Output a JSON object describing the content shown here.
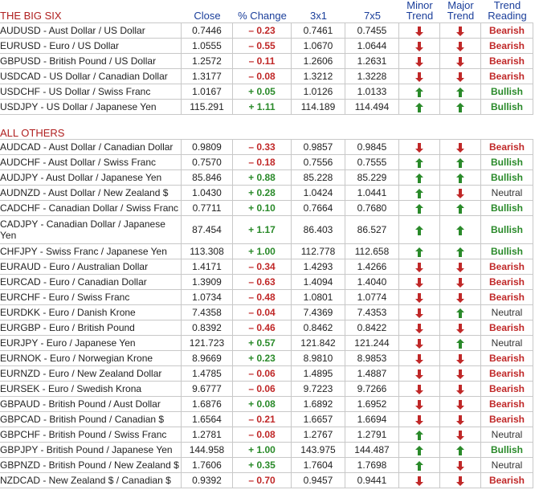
{
  "headers": {
    "section1": "THE BIG SIX",
    "close": "Close",
    "change": "% Change",
    "c3x1": "3x1",
    "c7x5": "7x5",
    "minor_top": "Minor",
    "minor_bottom": "Trend",
    "major_top": "Major",
    "major_bottom": "Trend",
    "reading_top": "Trend",
    "reading_bottom": "Reading"
  },
  "section2": "ALL OTHERS",
  "colors": {
    "up": "#2a8a2a",
    "down": "#c02828",
    "header": "#1a3e9a"
  },
  "big_six": [
    {
      "name": "AUDUSD - Aust Dollar / US Dollar",
      "close": "0.7446",
      "change": "– 0.23",
      "dir": "neg",
      "x31": "0.7461",
      "x75": "0.7455",
      "minor": "down",
      "major": "down",
      "reading": "Bearish"
    },
    {
      "name": "EURUSD - Euro / US Dollar",
      "close": "1.0555",
      "change": "– 0.55",
      "dir": "neg",
      "x31": "1.0670",
      "x75": "1.0644",
      "minor": "down",
      "major": "down",
      "reading": "Bearish"
    },
    {
      "name": "GBPUSD - British Pound / US Dollar",
      "close": "1.2572",
      "change": "– 0.11",
      "dir": "neg",
      "x31": "1.2606",
      "x75": "1.2631",
      "minor": "down",
      "major": "down",
      "reading": "Bearish"
    },
    {
      "name": "USDCAD - US Dollar / Canadian Dollar",
      "close": "1.3177",
      "change": "– 0.08",
      "dir": "neg",
      "x31": "1.3212",
      "x75": "1.3228",
      "minor": "down",
      "major": "down",
      "reading": "Bearish"
    },
    {
      "name": "USDCHF - US Dollar / Swiss Franc",
      "close": "1.0167",
      "change": "+ 0.05",
      "dir": "pos",
      "x31": "1.0126",
      "x75": "1.0133",
      "minor": "up",
      "major": "up",
      "reading": "Bullish"
    },
    {
      "name": "USDJPY - US Dollar / Japanese Yen",
      "close": "115.291",
      "change": "+ 1.11",
      "dir": "pos",
      "x31": "114.189",
      "x75": "114.494",
      "minor": "up",
      "major": "up",
      "reading": "Bullish"
    }
  ],
  "others": [
    {
      "name": "AUDCAD - Aust Dollar / Canadian Dollar",
      "close": "0.9809",
      "change": "– 0.33",
      "dir": "neg",
      "x31": "0.9857",
      "x75": "0.9845",
      "minor": "down",
      "major": "down",
      "reading": "Bearish"
    },
    {
      "name": "AUDCHF - Aust Dollar / Swiss Franc",
      "close": "0.7570",
      "change": "– 0.18",
      "dir": "neg",
      "x31": "0.7556",
      "x75": "0.7555",
      "minor": "up",
      "major": "up",
      "reading": "Bullish"
    },
    {
      "name": "AUDJPY - Aust Dollar / Japanese Yen",
      "close": "85.846",
      "change": "+ 0.88",
      "dir": "pos",
      "x31": "85.228",
      "x75": "85.229",
      "minor": "up",
      "major": "up",
      "reading": "Bullish"
    },
    {
      "name": "AUDNZD - Aust Dollar / New Zealand $",
      "close": "1.0430",
      "change": "+ 0.28",
      "dir": "pos",
      "x31": "1.0424",
      "x75": "1.0441",
      "minor": "up",
      "major": "down",
      "reading": "Neutral"
    },
    {
      "name": "CADCHF - Canadian Dollar / Swiss Franc",
      "close": "0.7711",
      "change": "+ 0.10",
      "dir": "pos",
      "x31": "0.7664",
      "x75": "0.7680",
      "minor": "up",
      "major": "up",
      "reading": "Bullish"
    },
    {
      "name": "CADJPY - Canadian Dollar / Japanese Yen",
      "close": "87.454",
      "change": "+ 1.17",
      "dir": "pos",
      "x31": "86.403",
      "x75": "86.527",
      "minor": "up",
      "major": "up",
      "reading": "Bullish",
      "tall": true
    },
    {
      "name": "CHFJPY - Swiss Franc / Japanese Yen",
      "close": "113.308",
      "change": "+ 1.00",
      "dir": "pos",
      "x31": "112.778",
      "x75": "112.658",
      "minor": "up",
      "major": "up",
      "reading": "Bullish"
    },
    {
      "name": "EURAUD - Euro / Australian Dollar",
      "close": "1.4171",
      "change": "– 0.34",
      "dir": "neg",
      "x31": "1.4293",
      "x75": "1.4266",
      "minor": "down",
      "major": "down",
      "reading": "Bearish"
    },
    {
      "name": "EURCAD - Euro / Canadian Dollar",
      "close": "1.3909",
      "change": "– 0.63",
      "dir": "neg",
      "x31": "1.4094",
      "x75": "1.4040",
      "minor": "down",
      "major": "down",
      "reading": "Bearish"
    },
    {
      "name": "EURCHF - Euro / Swiss Franc",
      "close": "1.0734",
      "change": "– 0.48",
      "dir": "neg",
      "x31": "1.0801",
      "x75": "1.0774",
      "minor": "down",
      "major": "down",
      "reading": "Bearish"
    },
    {
      "name": "EURDKK - Euro / Danish Krone",
      "close": "7.4358",
      "change": "– 0.04",
      "dir": "neg",
      "x31": "7.4369",
      "x75": "7.4353",
      "minor": "down",
      "major": "up",
      "reading": "Neutral"
    },
    {
      "name": "EURGBP - Euro / British Pound",
      "close": "0.8392",
      "change": "– 0.46",
      "dir": "neg",
      "x31": "0.8462",
      "x75": "0.8422",
      "minor": "down",
      "major": "down",
      "reading": "Bearish"
    },
    {
      "name": "EURJPY - Euro / Japanese Yen",
      "close": "121.723",
      "change": "+ 0.57",
      "dir": "pos",
      "x31": "121.842",
      "x75": "121.244",
      "minor": "down",
      "major": "up",
      "reading": "Neutral"
    },
    {
      "name": "EURNOK - Euro / Norwegian Krone",
      "close": "8.9669",
      "change": "+ 0.23",
      "dir": "pos",
      "x31": "8.9810",
      "x75": "8.9853",
      "minor": "down",
      "major": "down",
      "reading": "Bearish"
    },
    {
      "name": "EURNZD - Euro / New Zealand Dollar",
      "close": "1.4785",
      "change": "– 0.06",
      "dir": "neg",
      "x31": "1.4895",
      "x75": "1.4887",
      "minor": "down",
      "major": "down",
      "reading": "Bearish"
    },
    {
      "name": "EURSEK - Euro / Swedish Krona",
      "close": "9.6777",
      "change": "– 0.06",
      "dir": "neg",
      "x31": "9.7223",
      "x75": "9.7266",
      "minor": "down",
      "major": "down",
      "reading": "Bearish"
    },
    {
      "name": "GBPAUD - British Pound / Aust Dollar",
      "close": "1.6876",
      "change": "+ 0.08",
      "dir": "pos",
      "x31": "1.6892",
      "x75": "1.6952",
      "minor": "down",
      "major": "down",
      "reading": "Bearish"
    },
    {
      "name": "GBPCAD - British Pound / Canadian $",
      "close": "1.6564",
      "change": "– 0.21",
      "dir": "neg",
      "x31": "1.6657",
      "x75": "1.6694",
      "minor": "down",
      "major": "down",
      "reading": "Bearish"
    },
    {
      "name": "GBPCHF - British Pound / Swiss Franc",
      "close": "1.2781",
      "change": "– 0.08",
      "dir": "neg",
      "x31": "1.2767",
      "x75": "1.2791",
      "minor": "up",
      "major": "down",
      "reading": "Neutral"
    },
    {
      "name": "GBPJPY - British Pound / Japanese Yen",
      "close": "144.958",
      "change": "+ 1.00",
      "dir": "pos",
      "x31": "143.975",
      "x75": "144.487",
      "minor": "up",
      "major": "up",
      "reading": "Bullish"
    },
    {
      "name": "GBPNZD - British Pound / New Zealand $",
      "close": "1.7606",
      "change": "+ 0.35",
      "dir": "pos",
      "x31": "1.7604",
      "x75": "1.7698",
      "minor": "up",
      "major": "down",
      "reading": "Neutral"
    },
    {
      "name": "NZDCAD - New Zealand $ / Canadian $",
      "close": "0.9392",
      "change": "– 0.70",
      "dir": "neg",
      "x31": "0.9457",
      "x75": "0.9441",
      "minor": "down",
      "major": "down",
      "reading": "Bearish"
    }
  ]
}
